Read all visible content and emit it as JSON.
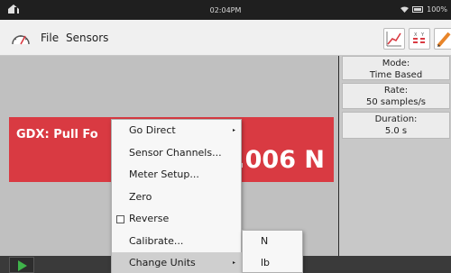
{
  "status_bar": {
    "time": "02:04PM",
    "battery": "100%"
  },
  "toolbar": {
    "menus": [
      "File",
      "Sensors"
    ],
    "buttons": [
      "graph-view",
      "table-view",
      "meter-view"
    ]
  },
  "meter": {
    "label": "GDX: Pull Fo",
    "value": ".006 N",
    "color": "#d93a42"
  },
  "data_collection": {
    "mode_label": "Mode:",
    "mode_value": "Time Based",
    "rate_label": "Rate:",
    "rate_value": "50 samples/s",
    "duration_label": "Duration:",
    "duration_value": "5.0 s"
  },
  "context_menu": {
    "items": [
      "Go Direct",
      "Sensor Channels...",
      "Meter Setup...",
      "Zero",
      "Reverse",
      "Calibrate...",
      "Change Units"
    ],
    "submenu_arrow": "▸"
  },
  "units_submenu": {
    "items": [
      "N",
      "lb"
    ]
  },
  "colors": {
    "accent_green": "#3fb34a",
    "meter_red": "#d93a42"
  }
}
